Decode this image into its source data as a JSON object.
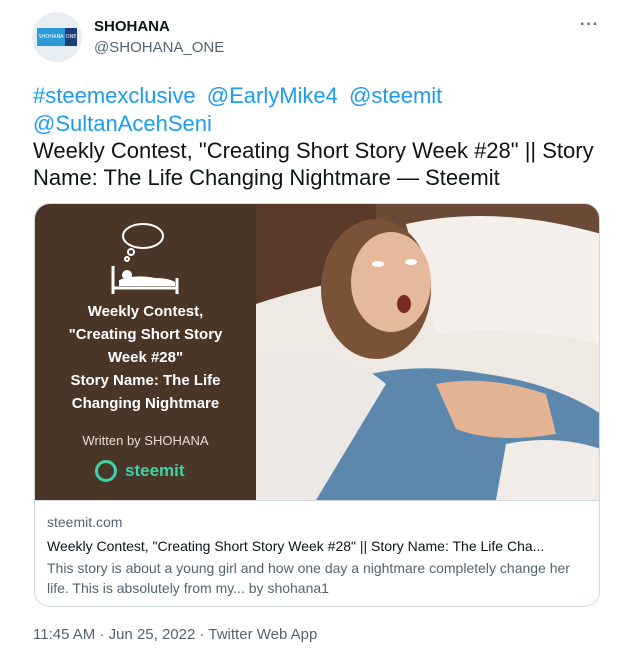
{
  "author": {
    "name": "SHOHANA",
    "handle": "@SHOHANA_ONE",
    "avatar_text_left": "SHOHANA",
    "avatar_text_right": "ONE"
  },
  "tweet": {
    "tags": [
      "#steemexclusive",
      "@EarlyMike4",
      "@steemit",
      "@SultanAcehSeni"
    ],
    "text": "Weekly Contest, \"Creating Short Story Week #28\" || Story Name: The Life Changing Nightmare — Steemit",
    "timestamp": "11:45 AM · Jun 25, 2022 · Twitter Web App"
  },
  "card": {
    "poster_title_lines": [
      "Weekly Contest,",
      "\"Creating Short Story",
      "Week #28\"",
      "Story Name: The Life",
      "Changing Nightmare"
    ],
    "poster_by": "Written by SHOHANA",
    "poster_brand": "steemit",
    "domain": "steemit.com",
    "title": "Weekly Contest, \"Creating Short Story Week #28\" || Story Name: The Life Cha...",
    "description": "This story is about a young girl and how one day a nightmare completely change her life. This is absolutely from my... by shohana1"
  },
  "colors": {
    "link": "#1d9bf0",
    "secondary_text": "#536471",
    "poster_bg": "#4a3529",
    "steemit_green": "#3ad6a6"
  },
  "icons": [
    "more-options-icon",
    "sleeping-bed-icon",
    "steemit-logo-icon"
  ]
}
